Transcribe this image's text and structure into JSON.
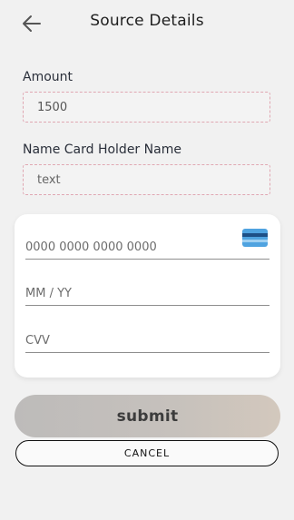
{
  "header": {
    "title": "Source Details",
    "back_icon": "arrow-left-icon"
  },
  "form": {
    "amount": {
      "label": "Amount",
      "value": "1500"
    },
    "card_holder": {
      "label": "Name Card Holder Name",
      "placeholder": "text"
    }
  },
  "card_panel": {
    "card_number_placeholder": "0000 0000 0000 0000",
    "expiry_placeholder": "MM / YY",
    "cvv_placeholder": "CVV",
    "card_icon": "credit-card-icon"
  },
  "actions": {
    "submit_label": "submit",
    "cancel_label": "CANCEL"
  },
  "colors": {
    "background": "#f1f1f1",
    "field_border": "#e0a7b2",
    "card_icon_blue": "#4fa3e0"
  }
}
